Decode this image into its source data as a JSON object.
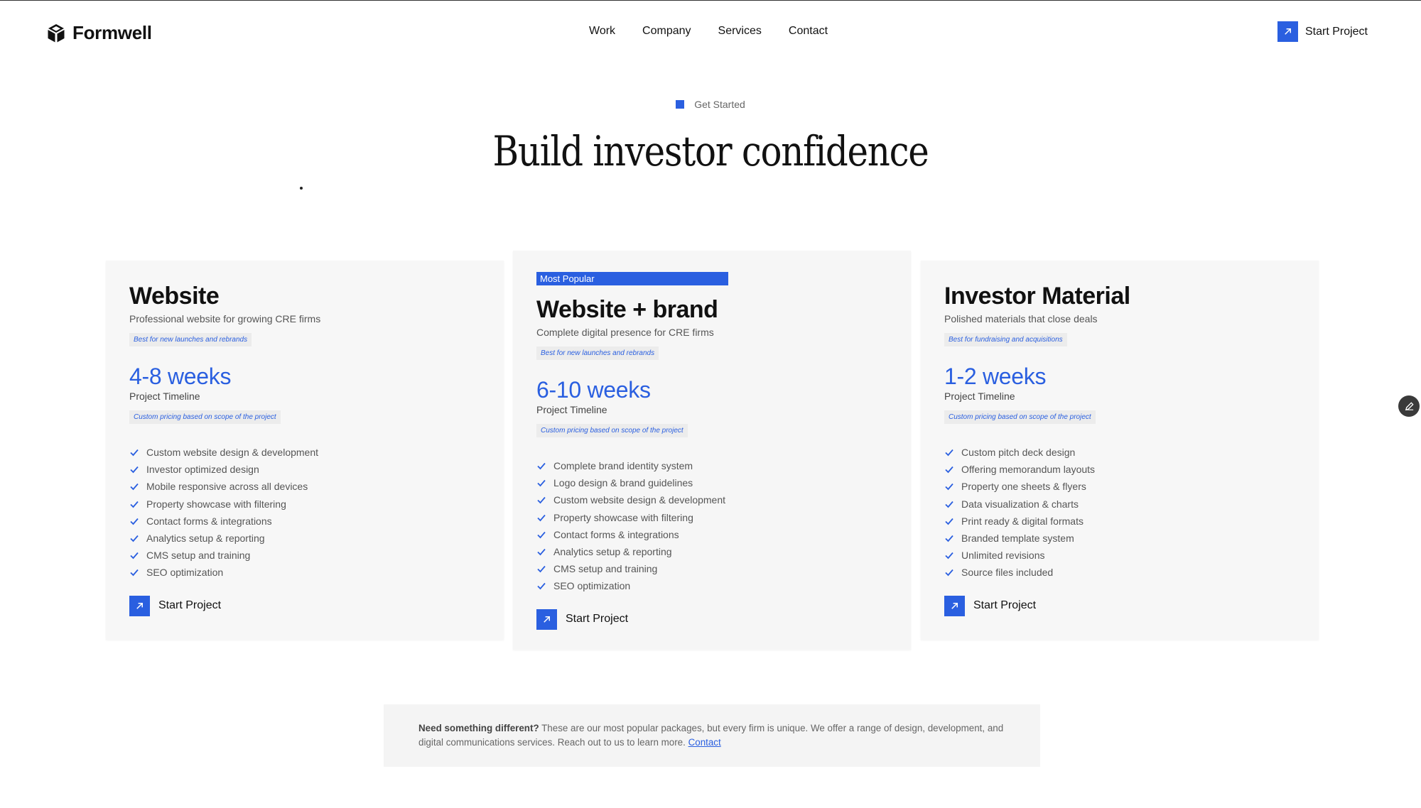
{
  "brand": {
    "name": "Formwell"
  },
  "nav": {
    "items": [
      "Work",
      "Company",
      "Services",
      "Contact"
    ]
  },
  "header": {
    "cta_label": "Start Project"
  },
  "hero": {
    "eyebrow": "Get Started",
    "title": "Build investor confidence"
  },
  "colors": {
    "accent": "#2a5fe0",
    "card_bg": "#f7f7f7",
    "text": "#111111"
  },
  "cards": [
    {
      "badge": "",
      "title": "Website",
      "subtitle": "Professional website for growing CRE firms",
      "chip": "Best for new launches and rebrands",
      "timeline": "4-8 weeks",
      "timeline_label": "Project Timeline",
      "pricing_note": "Custom pricing based on scope of the project",
      "features": [
        "Custom website design & development",
        "Investor optimized design",
        "Mobile responsive across all devices",
        "Property showcase with filtering",
        "Contact forms & integrations",
        "Analytics setup & reporting",
        "CMS setup and training",
        "SEO optimization"
      ],
      "cta": "Start Project"
    },
    {
      "badge": "Most Popular",
      "title": "Website + brand",
      "subtitle": "Complete digital presence for CRE firms",
      "chip": "Best for new launches and rebrands",
      "timeline": "6-10 weeks",
      "timeline_label": "Project Timeline",
      "pricing_note": "Custom pricing based on scope of the project",
      "features": [
        "Complete brand identity system",
        "Logo design & brand guidelines",
        "Custom website design & development",
        "Property showcase with filtering",
        "Contact forms & integrations",
        "Analytics setup & reporting",
        "CMS setup and training",
        "SEO optimization"
      ],
      "cta": "Start Project"
    },
    {
      "badge": "",
      "title": "Investor Material",
      "subtitle": "Polished materials that close deals",
      "chip": "Best for fundraising and acquisitions",
      "timeline": "1-2 weeks",
      "timeline_label": "Project Timeline",
      "pricing_note": "Custom pricing based on scope of the project",
      "features": [
        "Custom pitch deck design",
        "Offering memorandum layouts",
        "Property one sheets & flyers",
        "Data visualization & charts",
        "Print ready & digital formats",
        "Branded template system",
        "Unlimited revisions",
        "Source files included"
      ],
      "cta": "Start Project"
    }
  ],
  "note": {
    "lead": "Need something different?",
    "body": " These are our most popular packages, but every firm is unique. We offer a range of design, development, and digital communications services. Reach out to us to learn more. ",
    "link": "Contact"
  },
  "icons": {
    "logo": "cube-logo-icon",
    "cta": "arrow-up-right-icon",
    "feature": "check-icon",
    "fab": "pencil-icon"
  }
}
